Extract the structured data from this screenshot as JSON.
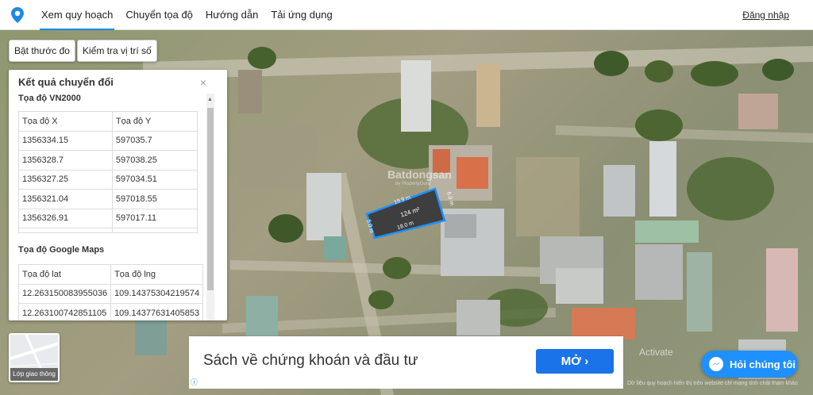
{
  "nav": {
    "items": [
      "Xem quy hoạch",
      "Chuyển tọa độ",
      "Hướng dẫn",
      "Tải ứng dụng"
    ],
    "login": "Đăng nhập"
  },
  "map_buttons": {
    "measure": "Bật thước đo",
    "check_location": "Kiểm tra vị trí số"
  },
  "panel": {
    "title": "Kết quả chuyển đổi",
    "close": "×",
    "vn2000": {
      "title": "Tọa độ VN2000",
      "headers": [
        "Tọa độ X",
        "Tọa độ Y"
      ],
      "rows": [
        [
          "1356334.15",
          "597035.7"
        ],
        [
          "1356328.7",
          "597038.25"
        ],
        [
          "1356327.25",
          "597034.51"
        ],
        [
          "1356321.04",
          "597018.55"
        ],
        [
          "1356326.91",
          "597017.11"
        ]
      ]
    },
    "google": {
      "title": "Tọa độ Google Maps",
      "headers": [
        "Tọa độ lat",
        "Tọa độ lng"
      ],
      "rows": [
        [
          "12.263150083955036",
          "109.14375304219574"
        ],
        [
          "12.263100742851105",
          "109.14377631405853"
        ]
      ]
    }
  },
  "plot": {
    "area": "124 m²",
    "edge_top": "19.9 m",
    "edge_bottom": "18.0 m",
    "edge_right": "6.0 m",
    "edge_left": "5.0 m",
    "watermark": "Batdongsan",
    "watermark_sub": "by PropertyGuru"
  },
  "traffic_layer": {
    "label": "Lớp giao thông"
  },
  "ad": {
    "text": "Sách về chứng khoán và đầu tư",
    "button": "MỞ ›",
    "icon": "ⓘ"
  },
  "chat": {
    "label": "Hỏi chúng tôi"
  },
  "disclaimer": "Dữ liệu quy hoạch hiển thị trên website chỉ mang tính chất tham khảo",
  "activate_text": "Activate"
}
